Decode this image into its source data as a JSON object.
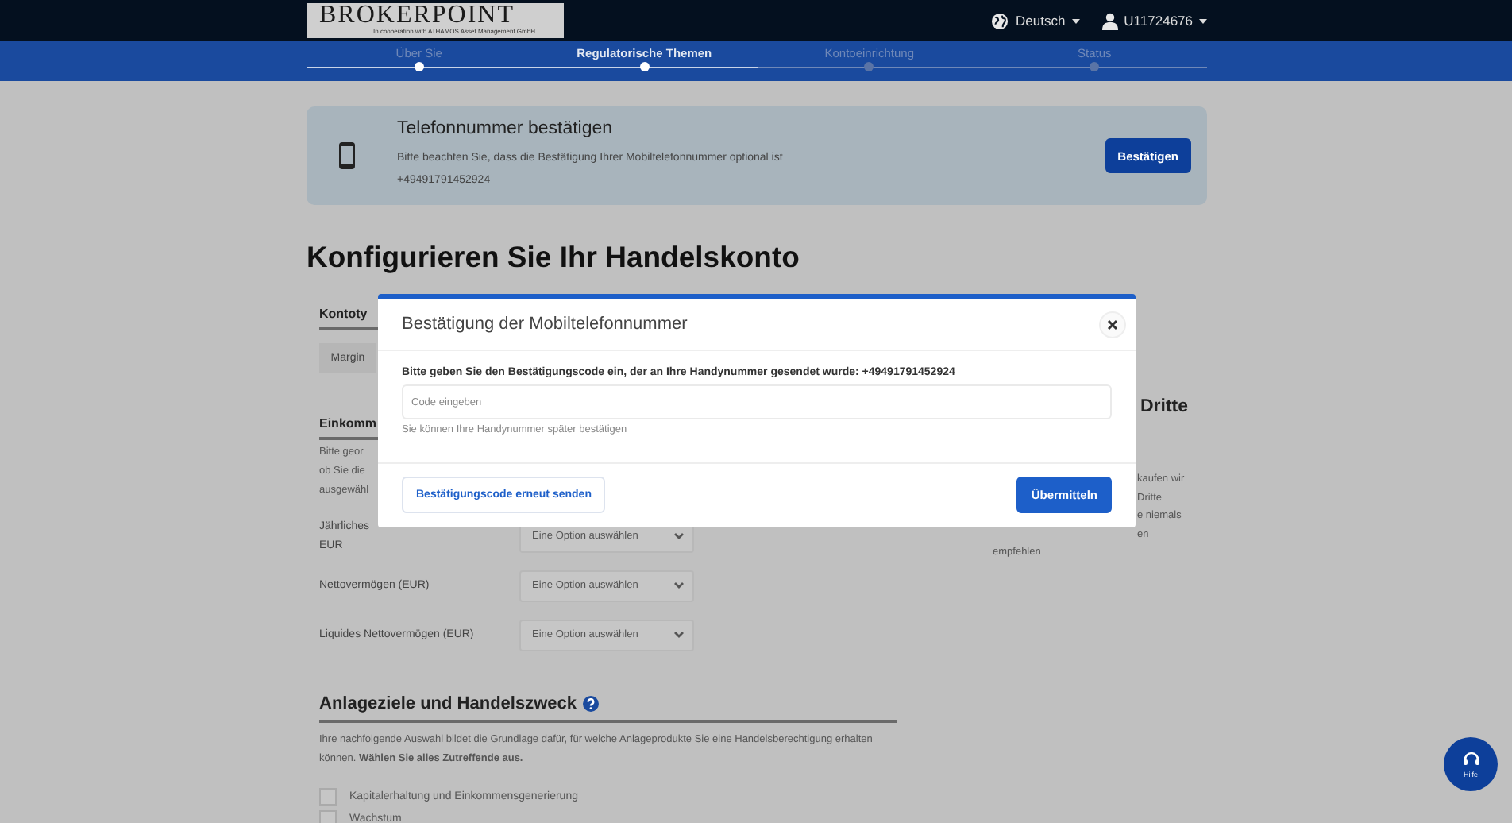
{
  "header": {
    "logo": {
      "name": "BROKERPOINT",
      "tagline": "In cooperation with ATHAMOS Asset Management GmbH"
    },
    "language": "Deutsch",
    "user": "U11724676"
  },
  "steps": [
    {
      "label": "Über Sie",
      "selected": false
    },
    {
      "label": "Regulatorische Themen",
      "selected": true
    },
    {
      "label": "Kontoeinrichtung",
      "selected": false
    },
    {
      "label": "Status",
      "selected": false
    }
  ],
  "banner": {
    "title": "Telefonnummer bestätigen",
    "text": "Bitte beachten Sie, dass die Bestätigung Ihrer Mobiltelefonnummer optional ist",
    "phone": "+49491791452924",
    "button": "Bestätigen"
  },
  "page_title": "Konfigurieren Sie Ihr Handelskonto",
  "account_type": {
    "heading": "Kontoty",
    "option": "Margin"
  },
  "income": {
    "heading": "Einkomm",
    "text_lines": [
      "Bitte geor",
      "ob Sie die",
      "ausgewähl"
    ],
    "fields": [
      {
        "label_lines": [
          "Jährliches",
          "EUR"
        ],
        "placeholder": "Eine Option auswählen"
      },
      {
        "label_lines": [
          "Nettovermögen (EUR)"
        ],
        "placeholder": "Eine Option auswählen"
      },
      {
        "label_lines": [
          "Liquides Nettovermögen (EUR)"
        ],
        "placeholder": "Eine Option auswählen"
      }
    ]
  },
  "goals": {
    "heading": "Anlageziele und Handelszweck",
    "text": "Ihre nachfolgende Auswahl bildet die Grundlage dafür, für welche Anlageprodukte Sie eine Handelsberechtigung erhalten können. **Wählen Sie alles Zutreffende aus.**",
    "options": [
      {
        "label": "Kapitalerhaltung und Einkommensgenerierung",
        "checked": false
      },
      {
        "label": "Wachstum",
        "checked": false
      }
    ]
  },
  "third_party": {
    "heading": "Dritte",
    "lines": [
      "kaufen wir",
      "Dritte",
      "e niemals",
      "en",
      "empfehlen"
    ]
  },
  "dialog": {
    "title": "Bestätigung der Mobiltelefonnummer",
    "instruction": "Bitte geben Sie den Bestätigungscode ein, der an Ihre Handynummer gesendet wurde: +49491791452924",
    "placeholder": "Code eingeben",
    "hint": "Sie können Ihre Handynummer später bestätigen",
    "resend_button": "Bestätigungscode erneut senden",
    "submit_button": "Übermitteln"
  },
  "help": {
    "label": "Hilfe"
  }
}
